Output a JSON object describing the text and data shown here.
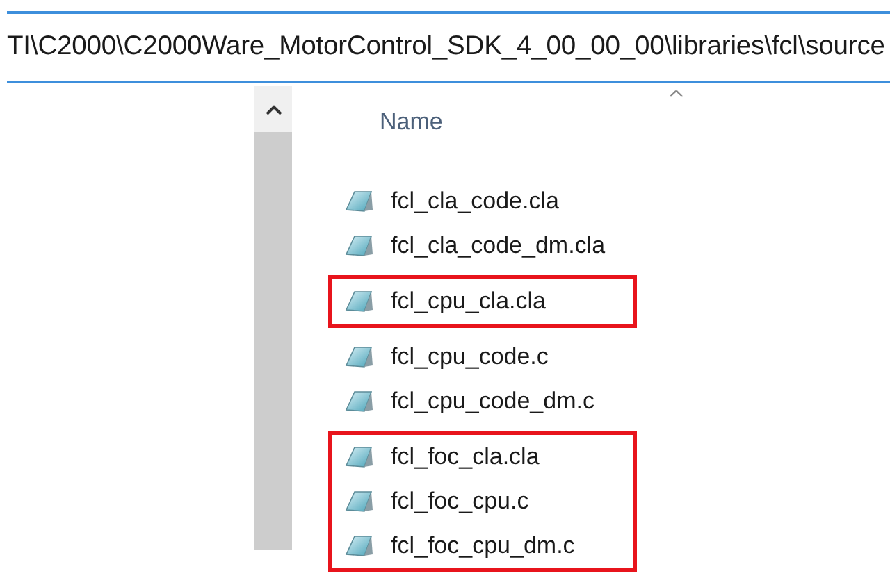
{
  "address_bar": {
    "path": "TI\\C2000\\C2000Ware_MotorControl_SDK_4_00_00_00\\libraries\\fcl\\source"
  },
  "column_header": {
    "label": "Name",
    "sort_caret": "^"
  },
  "files": [
    {
      "name": "fcl_cla_code.cla",
      "highlighted": false
    },
    {
      "name": "fcl_cla_code_dm.cla",
      "highlighted": false
    },
    {
      "name": "fcl_cpu_cla.cla",
      "highlighted": true
    },
    {
      "name": "fcl_cpu_code.c",
      "highlighted": false
    },
    {
      "name": "fcl_cpu_code_dm.c",
      "highlighted": false
    },
    {
      "name": "fcl_foc_cla.cla",
      "highlighted": true
    },
    {
      "name": "fcl_foc_cpu.c",
      "highlighted": true
    },
    {
      "name": "fcl_foc_cpu_dm.c",
      "highlighted": true
    }
  ]
}
